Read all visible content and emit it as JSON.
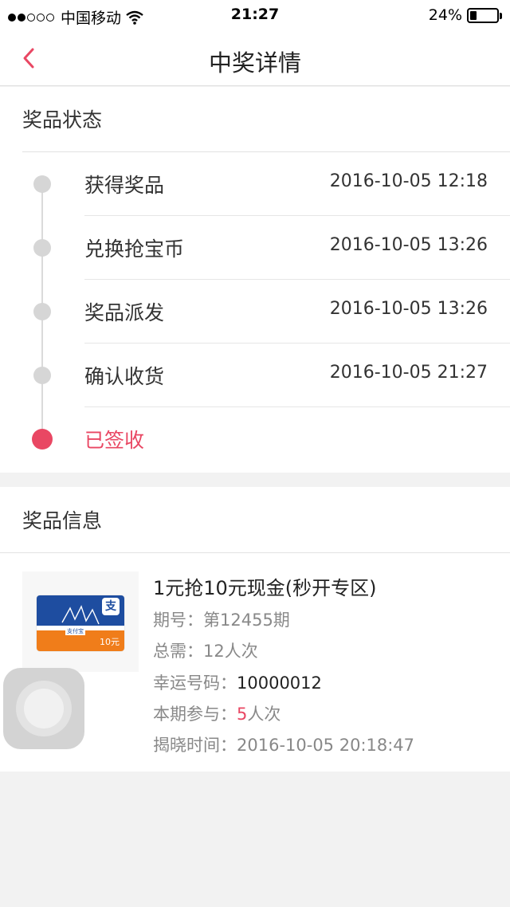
{
  "status_bar": {
    "carrier": "中国移动",
    "time": "21:27",
    "battery": "24%",
    "signal_bars_filled": 2,
    "signal_bars_total": 5
  },
  "nav": {
    "title": "中奖详情",
    "back_icon": "chevron-left-icon"
  },
  "colors": {
    "accent": "#e94763",
    "inactive_dot": "#d6d6d6"
  },
  "prize_status": {
    "header": "奖品状态",
    "steps": [
      {
        "label": "获得奖品",
        "time": "2016-10-05 12:18"
      },
      {
        "label": "兑换抢宝币",
        "time": "2016-10-05 13:26"
      },
      {
        "label": "奖品派发",
        "time": "2016-10-05 13:26"
      },
      {
        "label": "确认收货",
        "time": "2016-10-05 21:27"
      },
      {
        "label": "已签收",
        "time": ""
      }
    ]
  },
  "prize_info": {
    "header": "奖品信息",
    "product_title": "1元抢10元现金(秒开专区)",
    "card": {
      "zhi": "支",
      "brand": "支付宝",
      "value": "10元"
    },
    "period_label": "期号：",
    "period_value": "第12455期",
    "required_label": "总需：",
    "required_value": "12人次",
    "lucky_label": "幸运号码：",
    "lucky_value": "10000012",
    "joined_label": "本期参与：",
    "joined_count": "5",
    "joined_unit": "人次",
    "reveal_label": "揭晓时间：",
    "reveal_value": "2016-10-05 20:18:47"
  }
}
